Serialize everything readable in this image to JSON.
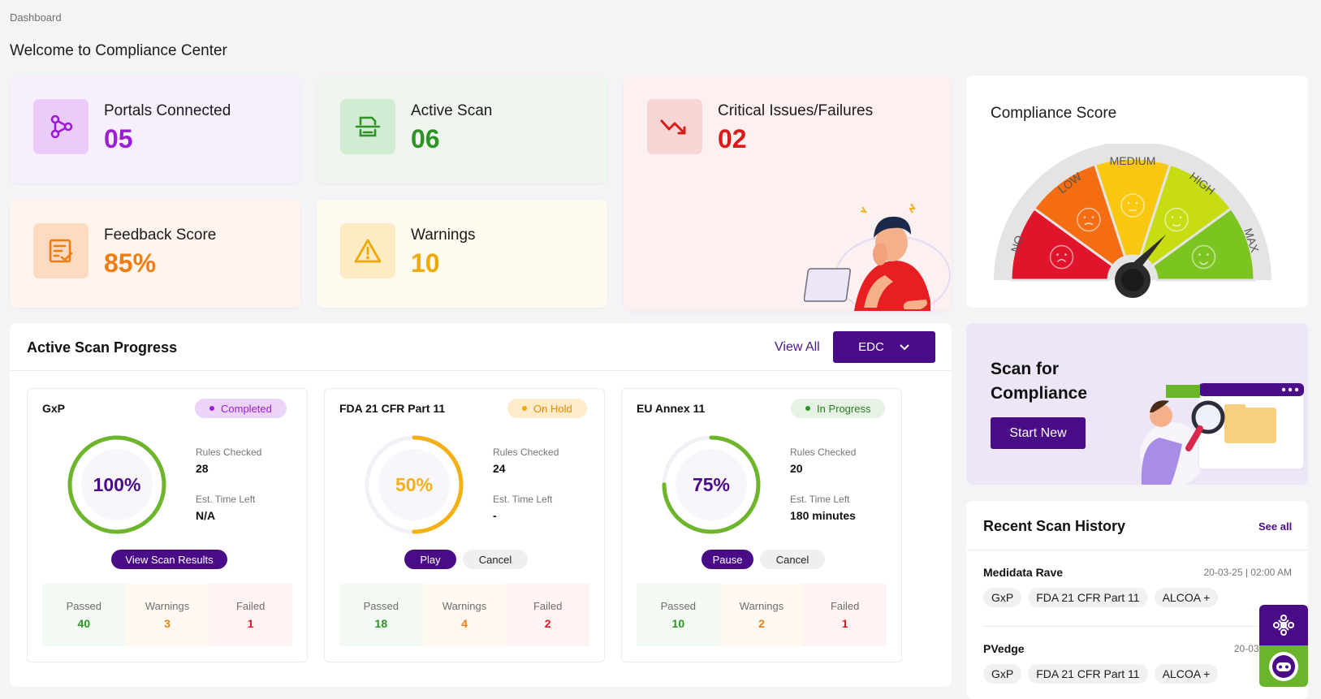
{
  "breadcrumb": "Dashboard",
  "page_title": "Welcome to Compliance Center",
  "stats": {
    "portals": {
      "label": "Portals Connected",
      "value": "05",
      "color": "#9b1ed6"
    },
    "active": {
      "label": "Active Scan",
      "value": "06",
      "color": "#2d9424"
    },
    "critical": {
      "label": "Critical Issues/Failures",
      "value": "02",
      "color": "#d81b1b"
    },
    "feedback": {
      "label": "Feedback Score",
      "value": "85%",
      "color": "#f07d12"
    },
    "warnings": {
      "label": "Warnings",
      "value": "10",
      "color": "#f0a808"
    }
  },
  "compliance": {
    "title": "Compliance Score",
    "levels": [
      "NO",
      "LOW",
      "MEDIUM",
      "HIGH",
      "MAX"
    ],
    "level_colors": [
      "#e0152b",
      "#f46d12",
      "#f9c70f",
      "#c8dc12",
      "#7cc41f"
    ],
    "needle_level": "HIGH"
  },
  "scan_progress": {
    "title": "Active Scan Progress",
    "view_all": "View All",
    "filter": "EDC",
    "cards": [
      {
        "name": "GxP",
        "status": "Completed",
        "percent": "100%",
        "progress": 1.0,
        "ring_color": "#6db52a",
        "text_color": "#4a0c86",
        "rules_label": "Rules Checked",
        "rules": "28",
        "time_label": "Est. Time Left",
        "time": "N/A",
        "actions": [
          "View Scan Results"
        ],
        "passed_label": "Passed",
        "passed": "40",
        "warnings_label": "Warnings",
        "warnings": "3",
        "failed_label": "Failed",
        "failed": "1"
      },
      {
        "name": "FDA 21 CFR Part 11",
        "status": "On Hold",
        "percent": "50%",
        "progress": 0.5,
        "ring_color": "#f5b014",
        "text_color": "#f5b014",
        "rules_label": "Rules Checked",
        "rules": "24",
        "time_label": "Est. Time Left",
        "time": "-",
        "actions": [
          "Play",
          "Cancel"
        ],
        "passed_label": "Passed",
        "passed": "18",
        "warnings_label": "Warnings",
        "warnings": "4",
        "failed_label": "Failed",
        "failed": "2"
      },
      {
        "name": "EU Annex 11",
        "status": "In Progress",
        "percent": "75%",
        "progress": 0.75,
        "ring_color": "#6db52a",
        "text_color": "#4a0c86",
        "rules_label": "Rules Checked",
        "rules": "20",
        "time_label": "Est. Time Left",
        "time": "180 minutes",
        "actions": [
          "Pause",
          "Cancel"
        ],
        "passed_label": "Passed",
        "passed": "10",
        "warnings_label": "Warnings",
        "warnings": "2",
        "failed_label": "Failed",
        "failed": "1"
      }
    ]
  },
  "scan_cta": {
    "title_line1": "Scan for",
    "title_line2": "Compliance",
    "button": "Start New"
  },
  "history": {
    "title": "Recent Scan History",
    "see_all": "See all",
    "items": [
      {
        "name": "Medidata Rave",
        "date": "20-03-25 | 02:00 AM",
        "tags": [
          "GxP",
          "FDA 21 CFR Part 11",
          "ALCOA +"
        ]
      },
      {
        "name": "PVedge",
        "date": "20-03-25 | 12",
        "tags": [
          "GxP",
          "FDA 21 CFR Part 11",
          "ALCOA +"
        ]
      }
    ]
  }
}
